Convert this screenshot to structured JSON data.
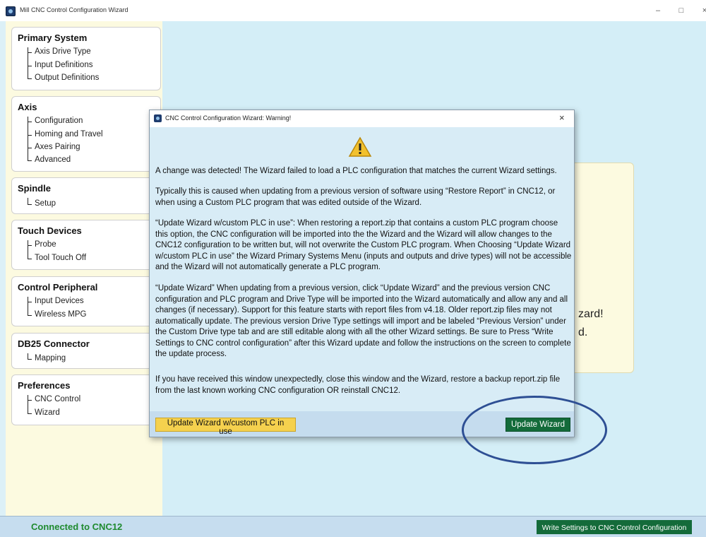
{
  "window": {
    "title": "Mill CNC Control Configuration Wizard",
    "minimize": "–",
    "maximize": "□",
    "close": "×"
  },
  "sidebar": {
    "groups": [
      {
        "title": "Primary System",
        "items": [
          "Axis Drive Type",
          "Input Definitions",
          "Output Definitions"
        ]
      },
      {
        "title": "Axis",
        "items": [
          "Configuration",
          "Homing and Travel",
          "Axes Pairing",
          "Advanced"
        ]
      },
      {
        "title": "Spindle",
        "items": [
          "Setup"
        ]
      },
      {
        "title": "Touch Devices",
        "items": [
          "Probe",
          "Tool Touch Off"
        ]
      },
      {
        "title": "Control Peripheral",
        "items": [
          "Input Devices",
          "Wireless MPG"
        ]
      },
      {
        "title": "DB25 Connector",
        "items": [
          "Mapping"
        ]
      },
      {
        "title": "Preferences",
        "items": [
          "CNC Control",
          "Wizard"
        ]
      }
    ]
  },
  "background_card": {
    "line1": "zard!",
    "line2": "d."
  },
  "dialog": {
    "title": "CNC Control Configuration Wizard: Warning!",
    "close": "×",
    "icon": "warning-icon",
    "messages": [
      "A change was detected! The Wizard failed to load a PLC configuration that matches the current Wizard settings.",
      "Typically this is caused when updating from a previous version of software using “Restore Report” in CNC12, or when using a Custom PLC program that was edited outside of the Wizard.",
      "“Update Wizard w/custom PLC in use”:   When restoring a report.zip that contains a custom PLC program choose this option, the CNC configuration will be imported into the the Wizard and the Wizard will allow changes to the CNC12 configuration to be written but, will not overwrite the Custom PLC program. When Choosing “Update Wizard w/custom PLC in use” the Wizard Primary Systems Menu (inputs and outputs and drive types) will not be accessible and the Wizard will not automatically generate a PLC program.",
      "“Update Wizard” When updating from a previous version, click “Update Wizard” and the previous version CNC configuration and PLC program and Drive Type will be imported into the Wizard automatically and allow any and all changes (if necessary). Support for this feature starts with report files from v4.18. Older report.zip files may not automatically update. The previous version Drive Type settings will import and be labeled “Previous Version” under the Custom Drive type tab and are still editable along with all the other Wizard settings. Be sure to Press “Write Settings to CNC control configuration” after this Wizard update and follow the instructions on the screen to complete the update process.",
      "If you have received this window unexpectedly, close this window and the Wizard, restore a backup report.zip file from the last known working CNC configuration OR reinstall CNC12."
    ],
    "btn_custom_plc": "Update Wizard w/custom PLC in use",
    "btn_update": "Update Wizard"
  },
  "statusbar": {
    "connection": "Connected to CNC12",
    "write_button": "Write Settings to CNC Control Configuration"
  },
  "colors": {
    "connected": "#1f8a2e",
    "primary_green": "#136b3a",
    "warning_yellow": "#f5d14e",
    "annotation_circle": "#2e4f94"
  }
}
